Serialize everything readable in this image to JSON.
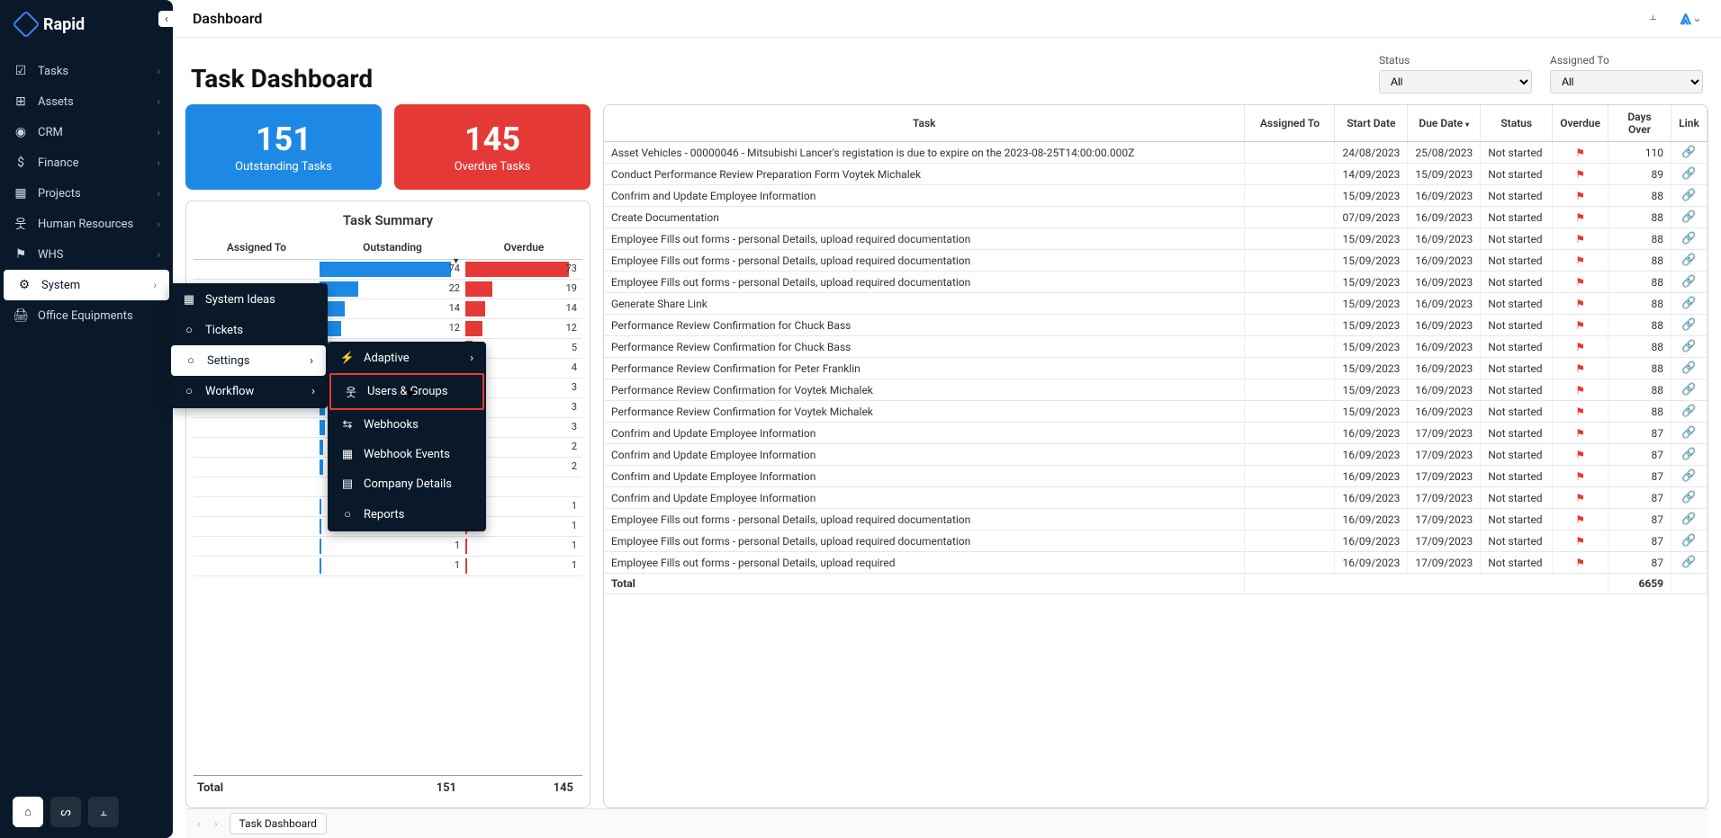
{
  "brand": "Rapid",
  "breadcrumb": "Dashboard",
  "page_title": "Task Dashboard",
  "sidebar": {
    "items": [
      {
        "label": "Tasks"
      },
      {
        "label": "Assets"
      },
      {
        "label": "CRM"
      },
      {
        "label": "Finance"
      },
      {
        "label": "Projects"
      },
      {
        "label": "Human Resources"
      },
      {
        "label": "WHS"
      },
      {
        "label": "System"
      },
      {
        "label": "Office Equipments"
      }
    ]
  },
  "submenu_system": [
    {
      "label": "System Ideas"
    },
    {
      "label": "Tickets"
    },
    {
      "label": "Settings"
    },
    {
      "label": "Workflow"
    }
  ],
  "submenu_settings": [
    {
      "label": "Adaptive"
    },
    {
      "label": "Users & Groups"
    },
    {
      "label": "Webhooks"
    },
    {
      "label": "Webhook Events"
    },
    {
      "label": "Company Details"
    },
    {
      "label": "Reports"
    }
  ],
  "filters": {
    "status_label": "Status",
    "status_value": "All",
    "assigned_label": "Assigned To",
    "assigned_value": "All"
  },
  "cards": {
    "outstanding_num": "151",
    "outstanding_label": "Outstanding Tasks",
    "overdue_num": "145",
    "overdue_label": "Overdue Tasks"
  },
  "summary": {
    "title": "Task Summary",
    "col_assigned": "Assigned To",
    "col_outstanding": "Outstanding",
    "col_overdue": "Overdue",
    "total_label": "Total",
    "total_outstanding": "151",
    "total_overdue": "145"
  },
  "chart_data": {
    "type": "bar",
    "title": "Task Summary",
    "categories_label": "Assigned To",
    "series": [
      {
        "name": "Outstanding",
        "values": [
          74,
          22,
          14,
          12,
          5,
          4,
          3,
          3,
          3,
          2,
          2,
          null,
          1,
          1,
          1,
          1
        ],
        "color": "#1e88e5"
      },
      {
        "name": "Overdue",
        "values": [
          73,
          19,
          14,
          12,
          5,
          4,
          3,
          3,
          3,
          2,
          2,
          null,
          1,
          1,
          1,
          1
        ],
        "color": "#e53935"
      }
    ],
    "totals": {
      "Outstanding": 151,
      "Overdue": 145
    }
  },
  "task_table": {
    "headers": [
      "Task",
      "Assigned To",
      "Start Date",
      "Due Date",
      "Status",
      "Overdue",
      "Days Over",
      "Link"
    ],
    "total_label": "Total",
    "total_days": "6659",
    "rows": [
      {
        "task": "Asset Vehicles - 00000046 - Mitsubishi Lancer's registation is due to expire on the 2023-08-25T14:00:00.000Z",
        "assigned": "",
        "start": "24/08/2023",
        "due": "25/08/2023",
        "status": "Not started",
        "days": "110"
      },
      {
        "task": "Conduct Performance Review Preparation Form Voytek Michalek",
        "assigned": "",
        "start": "14/09/2023",
        "due": "15/09/2023",
        "status": "Not started",
        "days": "89"
      },
      {
        "task": "Confrim and Update Employee Information",
        "assigned": "",
        "start": "15/09/2023",
        "due": "16/09/2023",
        "status": "Not started",
        "days": "88"
      },
      {
        "task": "Create Documentation",
        "assigned": "",
        "start": "07/09/2023",
        "due": "16/09/2023",
        "status": "Not started",
        "days": "88"
      },
      {
        "task": "Employee Fills out forms - personal Details, upload required documentation",
        "assigned": "",
        "start": "15/09/2023",
        "due": "16/09/2023",
        "status": "Not started",
        "days": "88"
      },
      {
        "task": "Employee Fills out forms - personal Details, upload required documentation",
        "assigned": "",
        "start": "15/09/2023",
        "due": "16/09/2023",
        "status": "Not started",
        "days": "88"
      },
      {
        "task": "Employee Fills out forms - personal Details, upload required documentation",
        "assigned": "",
        "start": "15/09/2023",
        "due": "16/09/2023",
        "status": "Not started",
        "days": "88"
      },
      {
        "task": "Generate Share Link",
        "assigned": "",
        "start": "15/09/2023",
        "due": "16/09/2023",
        "status": "Not started",
        "days": "88"
      },
      {
        "task": "Performance Review Confirmation for Chuck Bass",
        "assigned": "",
        "start": "15/09/2023",
        "due": "16/09/2023",
        "status": "Not started",
        "days": "88"
      },
      {
        "task": "Performance Review Confirmation for Chuck Bass",
        "assigned": "",
        "start": "15/09/2023",
        "due": "16/09/2023",
        "status": "Not started",
        "days": "88"
      },
      {
        "task": "Performance Review Confirmation for Peter Franklin",
        "assigned": "",
        "start": "15/09/2023",
        "due": "16/09/2023",
        "status": "Not started",
        "days": "88"
      },
      {
        "task": "Performance Review Confirmation for Voytek Michalek",
        "assigned": "",
        "start": "15/09/2023",
        "due": "16/09/2023",
        "status": "Not started",
        "days": "88"
      },
      {
        "task": "Performance Review Confirmation for Voytek Michalek",
        "assigned": "",
        "start": "15/09/2023",
        "due": "16/09/2023",
        "status": "Not started",
        "days": "88"
      },
      {
        "task": "Confrim and Update Employee Information",
        "assigned": "",
        "start": "16/09/2023",
        "due": "17/09/2023",
        "status": "Not started",
        "days": "87"
      },
      {
        "task": "Confrim and Update Employee Information",
        "assigned": "",
        "start": "16/09/2023",
        "due": "17/09/2023",
        "status": "Not started",
        "days": "87"
      },
      {
        "task": "Confrim and Update Employee Information",
        "assigned": "",
        "start": "16/09/2023",
        "due": "17/09/2023",
        "status": "Not started",
        "days": "87"
      },
      {
        "task": "Confrim and Update Employee Information",
        "assigned": "",
        "start": "16/09/2023",
        "due": "17/09/2023",
        "status": "Not started",
        "days": "87"
      },
      {
        "task": "Employee Fills out forms - personal Details, upload required documentation",
        "assigned": "",
        "start": "16/09/2023",
        "due": "17/09/2023",
        "status": "Not started",
        "days": "87"
      },
      {
        "task": "Employee Fills out forms - personal Details, upload required documentation",
        "assigned": "",
        "start": "16/09/2023",
        "due": "17/09/2023",
        "status": "Not started",
        "days": "87"
      },
      {
        "task": "Employee Fills out forms - personal Details, upload required",
        "assigned": "",
        "start": "16/09/2023",
        "due": "17/09/2023",
        "status": "Not started",
        "days": "87"
      }
    ]
  },
  "bottom_tab": "Task Dashboard"
}
